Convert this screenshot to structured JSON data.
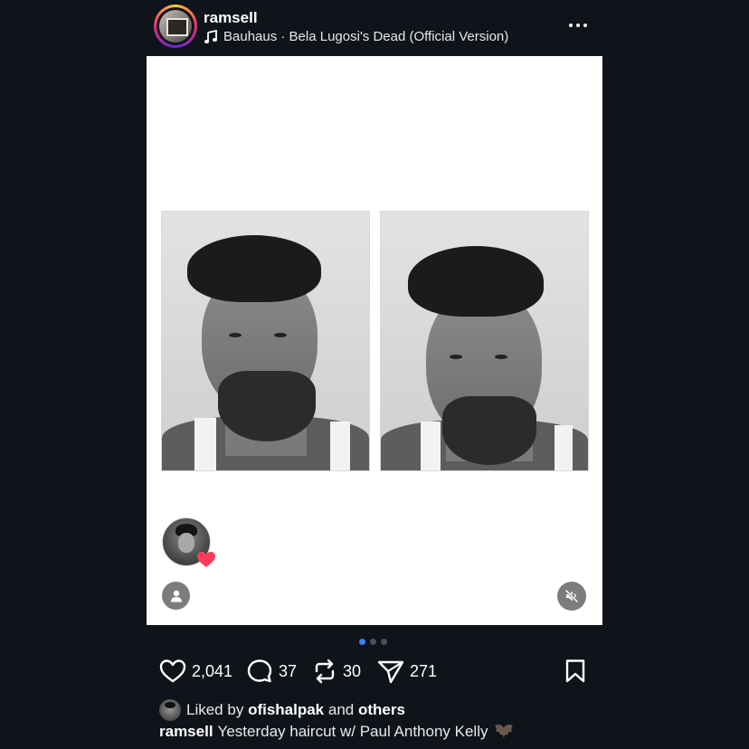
{
  "post": {
    "username": "ramsell",
    "music_icon": "music-note-icon",
    "song": "Bauhaus · Bela Lugosi's Dead (Official Version)",
    "more_icon": "more-options-icon"
  },
  "media": {
    "photos": [
      "photo-1",
      "photo-2"
    ],
    "user_tag_icon": "person-icon",
    "mute_icon": "speaker-muted-icon",
    "heart_color": "#ff3b5c"
  },
  "carousel": {
    "pages": 3,
    "active_index": 0,
    "active_color": "#3b82f6"
  },
  "actions": {
    "likes": "2,041",
    "comments": "37",
    "reposts": "30",
    "shares": "271"
  },
  "liked_by": {
    "prefix": "Liked by",
    "user": "ofishalpak",
    "connector": "and",
    "others": "others"
  },
  "caption": {
    "username": "ramsell",
    "text": "Yesterday haircut w/ Paul Anthony Kelly"
  },
  "colors": {
    "background": "#0f141a",
    "card": "#ffffff"
  }
}
